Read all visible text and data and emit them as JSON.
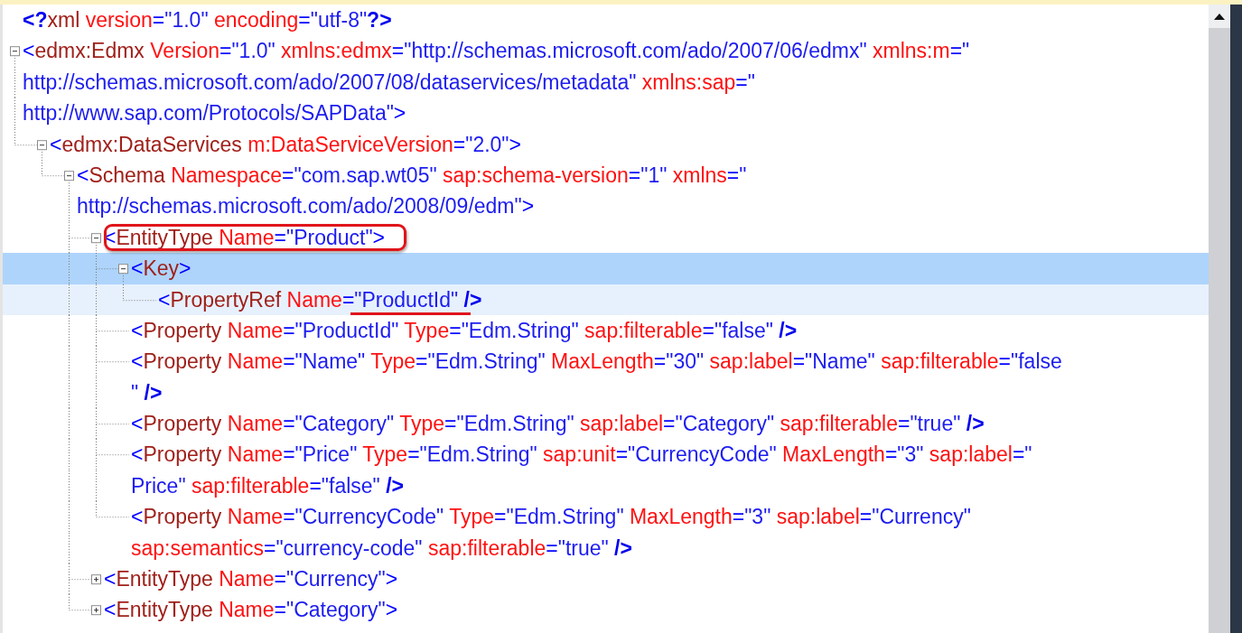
{
  "document": [
    {
      "selected": false,
      "hovered": false,
      "outlined": false,
      "lines": [
        [
          {
            "kind": "mark",
            "text": "<?"
          },
          {
            "kind": "tag",
            "text": "xml"
          },
          {
            "kind": "attr",
            "text": " version"
          },
          {
            "kind": "bracket",
            "text": "="
          },
          {
            "kind": "value",
            "text": "\"1.0\""
          },
          {
            "kind": "attr",
            "text": " encoding"
          },
          {
            "kind": "bracket",
            "text": "="
          },
          {
            "kind": "value",
            "text": "\"utf-8\""
          },
          {
            "kind": "mark",
            "text": "?>"
          }
        ]
      ]
    },
    {
      "selected": false,
      "hovered": false,
      "outlined": false,
      "expanded": true,
      "lines": [
        [
          {
            "kind": "bracket",
            "text": "<"
          },
          {
            "kind": "tag",
            "text": "edmx:Edmx"
          },
          {
            "kind": "attr",
            "text": " Version"
          },
          {
            "kind": "bracket",
            "text": "="
          },
          {
            "kind": "value",
            "text": "\"1.0\""
          },
          {
            "kind": "attr",
            "text": " xmlns:edmx"
          },
          {
            "kind": "bracket",
            "text": "="
          },
          {
            "kind": "value",
            "text": "\"http://schemas.microsoft.com/ado/2007/06/edmx\""
          },
          {
            "kind": "attr",
            "text": " xmlns:m"
          },
          {
            "kind": "bracket",
            "text": "="
          },
          {
            "kind": "value",
            "text": "\""
          }
        ],
        [
          {
            "kind": "value",
            "text": "http://schemas.microsoft.com/ado/2007/08/dataservices/metadata\""
          },
          {
            "kind": "attr",
            "text": " xmlns:sap"
          },
          {
            "kind": "bracket",
            "text": "="
          },
          {
            "kind": "value",
            "text": "\""
          }
        ],
        [
          {
            "kind": "value",
            "text": "http://www.sap.com/Protocols/SAPData\""
          },
          {
            "kind": "bracket",
            "text": ">"
          }
        ]
      ],
      "children": [
        {
          "selected": false,
          "hovered": false,
          "outlined": false,
          "expanded": true,
          "lines": [
            [
              {
                "kind": "bracket",
                "text": "<"
              },
              {
                "kind": "tag",
                "text": "edmx:DataServices"
              },
              {
                "kind": "attr",
                "text": " m:DataServiceVersion"
              },
              {
                "kind": "bracket",
                "text": "="
              },
              {
                "kind": "value",
                "text": "\"2.0\""
              },
              {
                "kind": "bracket",
                "text": ">"
              }
            ]
          ],
          "children": [
            {
              "selected": false,
              "hovered": false,
              "outlined": false,
              "expanded": true,
              "lines": [
                [
                  {
                    "kind": "bracket",
                    "text": "<"
                  },
                  {
                    "kind": "tag",
                    "text": "Schema"
                  },
                  {
                    "kind": "attr",
                    "text": " Namespace"
                  },
                  {
                    "kind": "bracket",
                    "text": "="
                  },
                  {
                    "kind": "value",
                    "text": "\"com.sap.wt05\""
                  },
                  {
                    "kind": "attr",
                    "text": " sap:schema-version"
                  },
                  {
                    "kind": "bracket",
                    "text": "="
                  },
                  {
                    "kind": "value",
                    "text": "\"1\""
                  },
                  {
                    "kind": "attr",
                    "text": " xmlns"
                  },
                  {
                    "kind": "bracket",
                    "text": "="
                  },
                  {
                    "kind": "value",
                    "text": "\""
                  }
                ],
                [
                  {
                    "kind": "value",
                    "text": "http://schemas.microsoft.com/ado/2008/09/edm\""
                  },
                  {
                    "kind": "bracket",
                    "text": ">"
                  }
                ]
              ],
              "children": [
                {
                  "selected": false,
                  "hovered": false,
                  "outlined": true,
                  "expanded": true,
                  "lines": [
                    [
                      {
                        "kind": "bracket",
                        "text": "<"
                      },
                      {
                        "kind": "tag",
                        "text": "EntityType"
                      },
                      {
                        "kind": "attr",
                        "text": " Name"
                      },
                      {
                        "kind": "bracket",
                        "text": "="
                      },
                      {
                        "kind": "value",
                        "text": "\"Product\""
                      },
                      {
                        "kind": "bracket",
                        "text": ">"
                      }
                    ]
                  ],
                  "children": [
                    {
                      "selected": true,
                      "hovered": false,
                      "outlined": false,
                      "expanded": true,
                      "lines": [
                        [
                          {
                            "kind": "bracket",
                            "text": "<"
                          },
                          {
                            "kind": "tag",
                            "text": "Key"
                          },
                          {
                            "kind": "bracket",
                            "text": ">"
                          }
                        ]
                      ],
                      "children": [
                        {
                          "selected": false,
                          "hovered": true,
                          "outlined": false,
                          "lines": [
                            [
                              {
                                "kind": "bracket",
                                "text": "<"
                              },
                              {
                                "kind": "tag",
                                "text": "PropertyRef"
                              },
                              {
                                "kind": "attr",
                                "text": " Name"
                              },
                              {
                                "kind": "bracket",
                                "text": "="
                              },
                              {
                                "kind": "value",
                                "text": "\"ProductId\"",
                                "underlined": true
                              },
                              {
                                "kind": "mark",
                                "text": " />"
                              }
                            ]
                          ]
                        }
                      ]
                    },
                    {
                      "selected": false,
                      "hovered": false,
                      "outlined": false,
                      "lines": [
                        [
                          {
                            "kind": "bracket",
                            "text": "<"
                          },
                          {
                            "kind": "tag",
                            "text": "Property"
                          },
                          {
                            "kind": "attr",
                            "text": " Name"
                          },
                          {
                            "kind": "bracket",
                            "text": "="
                          },
                          {
                            "kind": "value",
                            "text": "\"ProductId\""
                          },
                          {
                            "kind": "attr",
                            "text": " Type"
                          },
                          {
                            "kind": "bracket",
                            "text": "="
                          },
                          {
                            "kind": "value",
                            "text": "\"Edm.String\""
                          },
                          {
                            "kind": "attr",
                            "text": " sap:filterable"
                          },
                          {
                            "kind": "bracket",
                            "text": "="
                          },
                          {
                            "kind": "value",
                            "text": "\"false\""
                          },
                          {
                            "kind": "mark",
                            "text": " />"
                          }
                        ]
                      ]
                    },
                    {
                      "selected": false,
                      "hovered": false,
                      "outlined": false,
                      "lines": [
                        [
                          {
                            "kind": "bracket",
                            "text": "<"
                          },
                          {
                            "kind": "tag",
                            "text": "Property"
                          },
                          {
                            "kind": "attr",
                            "text": " Name"
                          },
                          {
                            "kind": "bracket",
                            "text": "="
                          },
                          {
                            "kind": "value",
                            "text": "\"Name\""
                          },
                          {
                            "kind": "attr",
                            "text": " Type"
                          },
                          {
                            "kind": "bracket",
                            "text": "="
                          },
                          {
                            "kind": "value",
                            "text": "\"Edm.String\""
                          },
                          {
                            "kind": "attr",
                            "text": " MaxLength"
                          },
                          {
                            "kind": "bracket",
                            "text": "="
                          },
                          {
                            "kind": "value",
                            "text": "\"30\""
                          },
                          {
                            "kind": "attr",
                            "text": " sap:label"
                          },
                          {
                            "kind": "bracket",
                            "text": "="
                          },
                          {
                            "kind": "value",
                            "text": "\"Name\""
                          },
                          {
                            "kind": "attr",
                            "text": " sap:filterable"
                          },
                          {
                            "kind": "bracket",
                            "text": "="
                          },
                          {
                            "kind": "value",
                            "text": "\"false"
                          }
                        ],
                        [
                          {
                            "kind": "value",
                            "text": "\""
                          },
                          {
                            "kind": "mark",
                            "text": " />"
                          }
                        ]
                      ]
                    },
                    {
                      "selected": false,
                      "hovered": false,
                      "outlined": false,
                      "lines": [
                        [
                          {
                            "kind": "bracket",
                            "text": "<"
                          },
                          {
                            "kind": "tag",
                            "text": "Property"
                          },
                          {
                            "kind": "attr",
                            "text": " Name"
                          },
                          {
                            "kind": "bracket",
                            "text": "="
                          },
                          {
                            "kind": "value",
                            "text": "\"Category\""
                          },
                          {
                            "kind": "attr",
                            "text": " Type"
                          },
                          {
                            "kind": "bracket",
                            "text": "="
                          },
                          {
                            "kind": "value",
                            "text": "\"Edm.String\""
                          },
                          {
                            "kind": "attr",
                            "text": " sap:label"
                          },
                          {
                            "kind": "bracket",
                            "text": "="
                          },
                          {
                            "kind": "value",
                            "text": "\"Category\""
                          },
                          {
                            "kind": "attr",
                            "text": " sap:filterable"
                          },
                          {
                            "kind": "bracket",
                            "text": "="
                          },
                          {
                            "kind": "value",
                            "text": "\"true\""
                          },
                          {
                            "kind": "mark",
                            "text": " />"
                          }
                        ]
                      ]
                    },
                    {
                      "selected": false,
                      "hovered": false,
                      "outlined": false,
                      "lines": [
                        [
                          {
                            "kind": "bracket",
                            "text": "<"
                          },
                          {
                            "kind": "tag",
                            "text": "Property"
                          },
                          {
                            "kind": "attr",
                            "text": " Name"
                          },
                          {
                            "kind": "bracket",
                            "text": "="
                          },
                          {
                            "kind": "value",
                            "text": "\"Price\""
                          },
                          {
                            "kind": "attr",
                            "text": " Type"
                          },
                          {
                            "kind": "bracket",
                            "text": "="
                          },
                          {
                            "kind": "value",
                            "text": "\"Edm.String\""
                          },
                          {
                            "kind": "attr",
                            "text": " sap:unit"
                          },
                          {
                            "kind": "bracket",
                            "text": "="
                          },
                          {
                            "kind": "value",
                            "text": "\"CurrencyCode\""
                          },
                          {
                            "kind": "attr",
                            "text": " MaxLength"
                          },
                          {
                            "kind": "bracket",
                            "text": "="
                          },
                          {
                            "kind": "value",
                            "text": "\"3\""
                          },
                          {
                            "kind": "attr",
                            "text": " sap:label"
                          },
                          {
                            "kind": "bracket",
                            "text": "="
                          },
                          {
                            "kind": "value",
                            "text": "\""
                          }
                        ],
                        [
                          {
                            "kind": "value",
                            "text": "Price\""
                          },
                          {
                            "kind": "attr",
                            "text": " sap:filterable"
                          },
                          {
                            "kind": "bracket",
                            "text": "="
                          },
                          {
                            "kind": "value",
                            "text": "\"false\""
                          },
                          {
                            "kind": "mark",
                            "text": " />"
                          }
                        ]
                      ]
                    },
                    {
                      "selected": false,
                      "hovered": false,
                      "outlined": false,
                      "lines": [
                        [
                          {
                            "kind": "bracket",
                            "text": "<"
                          },
                          {
                            "kind": "tag",
                            "text": "Property"
                          },
                          {
                            "kind": "attr",
                            "text": " Name"
                          },
                          {
                            "kind": "bracket",
                            "text": "="
                          },
                          {
                            "kind": "value",
                            "text": "\"CurrencyCode\""
                          },
                          {
                            "kind": "attr",
                            "text": " Type"
                          },
                          {
                            "kind": "bracket",
                            "text": "="
                          },
                          {
                            "kind": "value",
                            "text": "\"Edm.String\""
                          },
                          {
                            "kind": "attr",
                            "text": " MaxLength"
                          },
                          {
                            "kind": "bracket",
                            "text": "="
                          },
                          {
                            "kind": "value",
                            "text": "\"3\""
                          },
                          {
                            "kind": "attr",
                            "text": " sap:label"
                          },
                          {
                            "kind": "bracket",
                            "text": "="
                          },
                          {
                            "kind": "value",
                            "text": "\"Currency\""
                          }
                        ],
                        [
                          {
                            "kind": "attr",
                            "text": "sap:semantics"
                          },
                          {
                            "kind": "bracket",
                            "text": "="
                          },
                          {
                            "kind": "value",
                            "text": "\"currency-code\""
                          },
                          {
                            "kind": "attr",
                            "text": " sap:filterable"
                          },
                          {
                            "kind": "bracket",
                            "text": "="
                          },
                          {
                            "kind": "value",
                            "text": "\"true\""
                          },
                          {
                            "kind": "mark",
                            "text": " />"
                          }
                        ]
                      ]
                    }
                  ]
                },
                {
                  "selected": false,
                  "hovered": false,
                  "outlined": false,
                  "expanded": false,
                  "lines": [
                    [
                      {
                        "kind": "bracket",
                        "text": "<"
                      },
                      {
                        "kind": "tag",
                        "text": "EntityType"
                      },
                      {
                        "kind": "attr",
                        "text": " Name"
                      },
                      {
                        "kind": "bracket",
                        "text": "="
                      },
                      {
                        "kind": "value",
                        "text": "\"Currency\""
                      },
                      {
                        "kind": "bracket",
                        "text": ">"
                      }
                    ]
                  ]
                },
                {
                  "selected": false,
                  "hovered": false,
                  "outlined": false,
                  "expanded": false,
                  "lines": [
                    [
                      {
                        "kind": "bracket",
                        "text": "<"
                      },
                      {
                        "kind": "tag",
                        "text": "EntityType"
                      },
                      {
                        "kind": "attr",
                        "text": " Name"
                      },
                      {
                        "kind": "bracket",
                        "text": "="
                      },
                      {
                        "kind": "value",
                        "text": "\"Category\""
                      },
                      {
                        "kind": "bracket",
                        "text": ">"
                      }
                    ]
                  ]
                }
              ]
            }
          ]
        }
      ]
    }
  ]
}
